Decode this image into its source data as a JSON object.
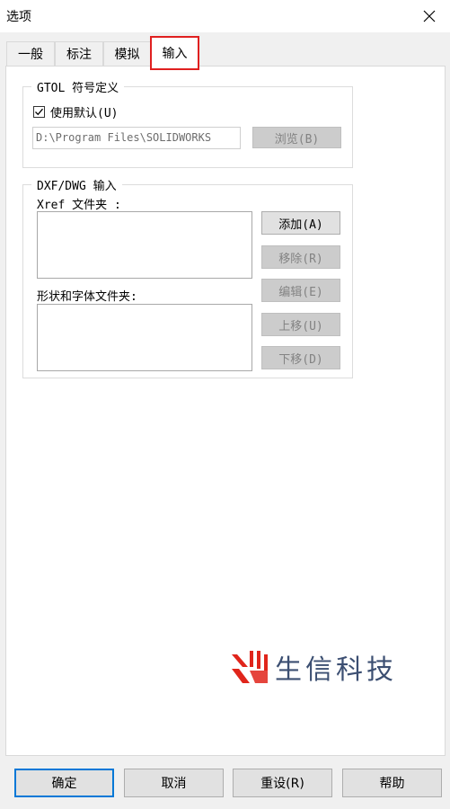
{
  "window": {
    "title": "选项"
  },
  "tabs": [
    {
      "label": "一般"
    },
    {
      "label": "标注"
    },
    {
      "label": "模拟"
    },
    {
      "label": "输入",
      "active": true
    }
  ],
  "gtol": {
    "caption": "GTOL 符号定义",
    "use_default_label": "使用默认(U)",
    "use_default_checked": true,
    "path_value": "D:\\Program Files\\SOLIDWORKS",
    "browse_label": "浏览(B)"
  },
  "dxf": {
    "caption": "DXF/DWG 输入",
    "xref_label": "Xref 文件夹 :",
    "shape_label": "形状和字体文件夹:",
    "buttons": {
      "add": "添加(A)",
      "remove": "移除(R)",
      "edit": "编辑(E)",
      "up": "上移(U)",
      "down": "下移(D)"
    }
  },
  "watermark": {
    "text": "生信科技",
    "accent_color": "#e0251b",
    "text_color": "#3c4f72"
  },
  "footer": {
    "ok": "确定",
    "cancel": "取消",
    "reset": "重设(R)",
    "help": "帮助"
  },
  "colors": {
    "active_tab_highlight": "#e02020",
    "default_button_border": "#0078d7"
  }
}
